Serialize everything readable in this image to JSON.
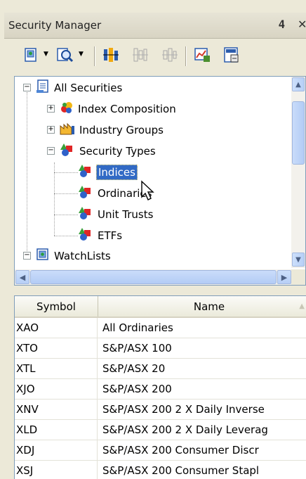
{
  "window": {
    "title": "Security Manager",
    "pin_icon": "pin-icon",
    "close_icon": "close-icon"
  },
  "toolbar": {
    "buttons": [
      "new-security-icon",
      "find-security-icon",
      "chart-icon",
      "chart-disabled-icon",
      "chart-disabled-icon-2",
      "watchlist-chart-icon",
      "calculator-icon"
    ]
  },
  "tree": {
    "nodes": [
      {
        "label": "All Securities",
        "icon": "securities-book-icon",
        "expander": "−"
      },
      {
        "label": "Index Composition",
        "icon": "index-composition-icon",
        "expander": "+"
      },
      {
        "label": "Industry Groups",
        "icon": "industry-groups-icon",
        "expander": "+"
      },
      {
        "label": "Security Types",
        "icon": "security-types-icon",
        "expander": "−"
      },
      {
        "label": "Indices",
        "icon": "shapes-icon"
      },
      {
        "label": "Ordinaries",
        "icon": "shapes-icon"
      },
      {
        "label": "Unit Trusts",
        "icon": "shapes-icon"
      },
      {
        "label": "ETFs",
        "icon": "shapes-icon"
      },
      {
        "label": "WatchLists",
        "icon": "watchlist-icon",
        "expander": "−"
      }
    ],
    "selected": "Indices"
  },
  "table": {
    "columns": [
      "Symbol",
      "Name"
    ],
    "rows": [
      {
        "symbol": "XAO",
        "name": "All Ordinaries"
      },
      {
        "symbol": "XTO",
        "name": "S&P/ASX 100"
      },
      {
        "symbol": "XTL",
        "name": "S&P/ASX 20"
      },
      {
        "symbol": "XJO",
        "name": "S&P/ASX 200"
      },
      {
        "symbol": "XNV",
        "name": "S&P/ASX 200 2 X Daily Inverse"
      },
      {
        "symbol": "XLD",
        "name": "S&P/ASX 200 2 X Daily Leverag"
      },
      {
        "symbol": "XDJ",
        "name": "S&P/ASX 200 Consumer Discr"
      },
      {
        "symbol": "XSJ",
        "name": "S&P/ASX 200 Consumer Stapl"
      }
    ]
  },
  "colors": {
    "selection": "#316ac5",
    "panel": "#ece9d8",
    "border": "#7f9db9"
  }
}
